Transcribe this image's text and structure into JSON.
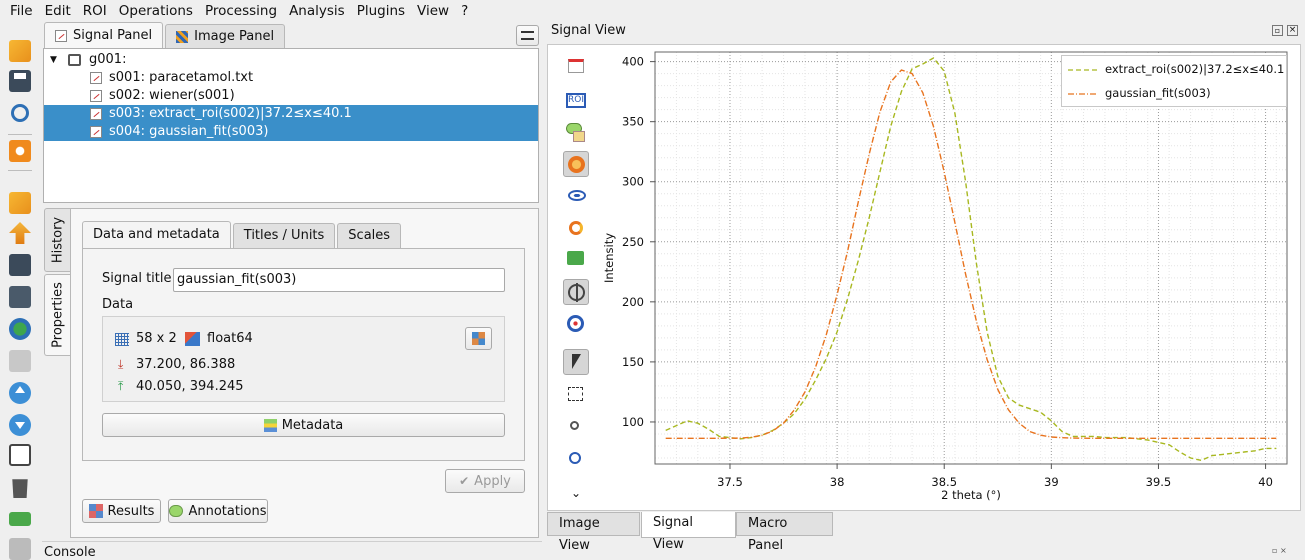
{
  "menu": [
    "File",
    "Edit",
    "ROI",
    "Operations",
    "Processing",
    "Analysis",
    "Plugins",
    "View",
    "?"
  ],
  "left_tabs": {
    "signal_panel": "Signal Panel",
    "image_panel": "Image Panel"
  },
  "tree": {
    "group": "g001:",
    "items": [
      {
        "label": "s001: paracetamol.txt",
        "selected": false
      },
      {
        "label": "s002: wiener(s001)",
        "selected": false
      },
      {
        "label": "s003: extract_roi(s002)|37.2≤x≤40.1",
        "selected": true
      },
      {
        "label": "s004: gaussian_fit(s003)",
        "selected": true
      }
    ]
  },
  "side_tabs": {
    "history": "History",
    "properties": "Properties"
  },
  "props_tabs": {
    "data": "Data and metadata",
    "titles": "Titles / Units",
    "scales": "Scales"
  },
  "props": {
    "signal_title_label": "Signal title",
    "signal_title_value": "gaussian_fit(s003)",
    "data_label": "Data",
    "shape": "58 x 2",
    "dtype": "float64",
    "min": "37.200, 86.388",
    "max": "40.050, 394.245",
    "metadata_button": "Metadata",
    "apply_button": "Apply",
    "results_button": "Results",
    "annotations_button": "Annotations"
  },
  "console_title": "Console",
  "signal_view": {
    "title": "Signal View"
  },
  "bottom_tabs": [
    "Image View",
    "Signal View",
    "Macro Panel"
  ],
  "chart_data": {
    "type": "line",
    "xlabel": "2 theta (°)",
    "ylabel": "Intensity",
    "xlim": [
      37.15,
      40.1
    ],
    "ylim": [
      65,
      408
    ],
    "xticks": [
      37.5,
      38,
      38.5,
      39,
      39.5,
      40
    ],
    "yticks": [
      100,
      150,
      200,
      250,
      300,
      350,
      400
    ],
    "grid": true,
    "legend_position": "top-right",
    "series": [
      {
        "name": "extract_roi(s002)|37.2≤x≤40.1",
        "color": "#a8b820",
        "x": [
          37.2,
          37.25,
          37.3,
          37.35,
          37.4,
          37.45,
          37.5,
          37.55,
          37.6,
          37.65,
          37.7,
          37.75,
          37.8,
          37.85,
          37.9,
          37.95,
          38.0,
          38.05,
          38.1,
          38.15,
          38.2,
          38.25,
          38.3,
          38.35,
          38.4,
          38.45,
          38.5,
          38.55,
          38.6,
          38.65,
          38.7,
          38.75,
          38.8,
          38.85,
          38.9,
          38.95,
          39.0,
          39.05,
          39.1,
          39.15,
          39.2,
          39.25,
          39.3,
          39.35,
          39.4,
          39.45,
          39.5,
          39.55,
          39.6,
          39.65,
          39.7,
          39.75,
          39.8,
          39.85,
          39.9,
          39.95,
          40.0,
          40.05
        ],
        "y": [
          93,
          97,
          101,
          99,
          94,
          88,
          87,
          86,
          87,
          89,
          93,
          99,
          107,
          119,
          135,
          153,
          175,
          203,
          235,
          270,
          308,
          346,
          375,
          394,
          398,
          403,
          392,
          357,
          300,
          232,
          175,
          138,
          120,
          114,
          111,
          108,
          101,
          92,
          88,
          88,
          88,
          87,
          87,
          87,
          86,
          85,
          83,
          81,
          75,
          70,
          68,
          72,
          73,
          74,
          75,
          76,
          78,
          78
        ]
      },
      {
        "name": "gaussian_fit(s003)",
        "color": "#e8731e",
        "x": [
          37.2,
          37.3,
          37.4,
          37.5,
          37.55,
          37.6,
          37.65,
          37.7,
          37.75,
          37.8,
          37.85,
          37.9,
          37.95,
          38.0,
          38.05,
          38.1,
          38.15,
          38.2,
          38.25,
          38.3,
          38.35,
          38.4,
          38.45,
          38.5,
          38.55,
          38.6,
          38.65,
          38.7,
          38.75,
          38.8,
          38.85,
          38.9,
          38.95,
          39.0,
          39.05,
          39.1,
          39.2,
          39.3,
          39.5,
          39.7,
          39.9,
          40.05
        ],
        "y": [
          86.4,
          86.4,
          86.4,
          86.5,
          86.6,
          87.3,
          89,
          92.5,
          99,
          110,
          125,
          146,
          173,
          206,
          243,
          284,
          323,
          358,
          383,
          393,
          390,
          374,
          346,
          308,
          266,
          223,
          184,
          152,
          127,
          110,
          99,
          92,
          89,
          87.5,
          86.9,
          86.6,
          86.4,
          86.4,
          86.4,
          86.4,
          86.4,
          86.4
        ]
      }
    ]
  }
}
